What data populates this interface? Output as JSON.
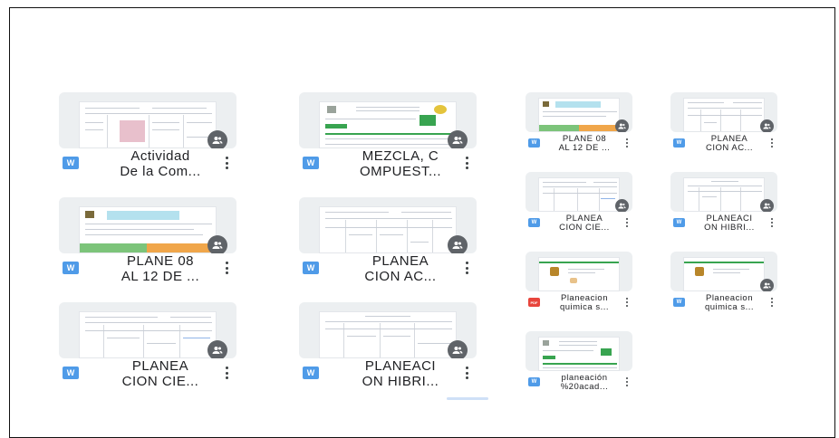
{
  "colors": {
    "word_badge": "#4f9be8",
    "pdf_badge": "#e8453c",
    "shared_badge": "#5f6368",
    "thumb_bg": "#eceff1",
    "green_band": "#38a450",
    "orange_band": "#f0a64a",
    "pink_band": "#e8c0cc",
    "cyan_band": "#b4e1ee"
  },
  "icons": {
    "shared": "people-icon",
    "kebab": "more-vert-icon"
  },
  "files": [
    {
      "name_line1": "Actividad",
      "name_line2": "De la Com...",
      "type": "word",
      "badge": "W",
      "shared": true
    },
    {
      "name_line1": "MEZCLA, C",
      "name_line2": "OMPUEST...",
      "type": "word",
      "badge": "W",
      "shared": true
    },
    {
      "name_line1": "PLANE 08",
      "name_line2": "AL 12 DE ...",
      "type": "word",
      "badge": "W",
      "shared": true
    },
    {
      "name_line1": "PLANEA",
      "name_line2": "CION AC...",
      "type": "word",
      "badge": "W",
      "shared": true
    },
    {
      "name_line1": "PLANEA",
      "name_line2": "CION CIE...",
      "type": "word",
      "badge": "W",
      "shared": true
    },
    {
      "name_line1": "PLANEACI",
      "name_line2": "ON HIBRI...",
      "type": "word",
      "badge": "W",
      "shared": true
    },
    {
      "name_line1": "PLANE 08",
      "name_line2": "AL 12 DE ...",
      "type": "word",
      "badge": "W",
      "shared": true
    },
    {
      "name_line1": "PLANEA",
      "name_line2": "CION AC...",
      "type": "word",
      "badge": "W",
      "shared": true
    },
    {
      "name_line1": "PLANEA",
      "name_line2": "CION CIE...",
      "type": "word",
      "badge": "W",
      "shared": true
    },
    {
      "name_line1": "PLANEACI",
      "name_line2": "ON HIBRI...",
      "type": "word",
      "badge": "W",
      "shared": true
    },
    {
      "name_line1": "Planeacion",
      "name_line2": "quimica s...",
      "type": "pdf",
      "badge": "PDF",
      "shared": false
    },
    {
      "name_line1": "Planeacion",
      "name_line2": "quimica s...",
      "type": "word",
      "badge": "W",
      "shared": true
    },
    {
      "name_line1": "planeación",
      "name_line2": "%20acad...",
      "type": "word",
      "badge": "W",
      "shared": false
    }
  ]
}
